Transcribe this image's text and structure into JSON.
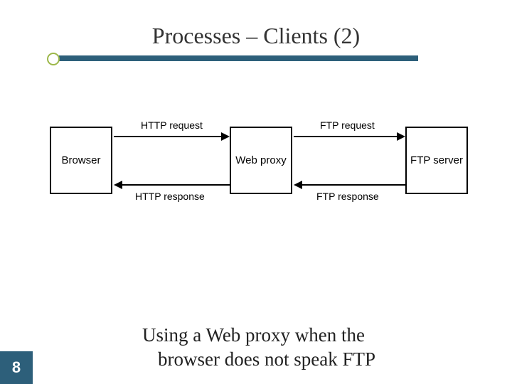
{
  "title": "Processes – Clients (2)",
  "diagram": {
    "boxes": {
      "browser": "Browser",
      "proxy": "Web proxy",
      "server": "FTP server"
    },
    "arrows": {
      "http_request": "HTTP request",
      "http_response": "HTTP response",
      "ftp_request": "FTP request",
      "ftp_response": "FTP response"
    }
  },
  "caption": {
    "line1": "Using a Web proxy when the",
    "line2": "browser does not speak FTP"
  },
  "slide_number": "8",
  "colors": {
    "accent": "#2d5f7a",
    "bullet": "#9db84a"
  }
}
